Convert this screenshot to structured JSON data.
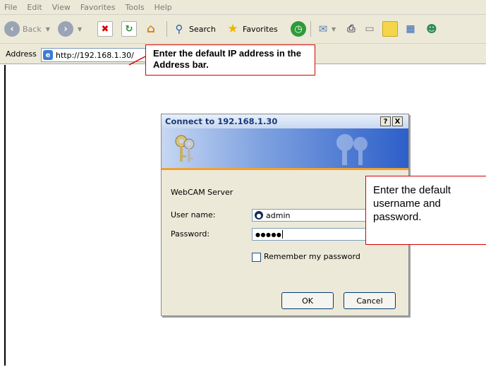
{
  "menu": [
    "File",
    "Edit",
    "View",
    "Favorites",
    "Tools",
    "Help"
  ],
  "toolbar": {
    "back_label": "Back",
    "search_label": "Search",
    "favorites_label": "Favorites"
  },
  "address": {
    "label": "Address",
    "url": "http://192.168.1.30/"
  },
  "callouts": {
    "ip_hint": "Enter the default IP address in the Address bar.",
    "cred_hint": "Enter the default username and password."
  },
  "dialog": {
    "title": "Connect to 192.168.1.30",
    "help_btn": "?",
    "close_btn": "X",
    "server": "WebCAM Server",
    "username_label": "User name:",
    "username_value": "admin",
    "password_label": "Password:",
    "password_value": "●●●●●",
    "remember_label": "Remember my password",
    "ok_label": "OK",
    "cancel_label": "Cancel"
  }
}
